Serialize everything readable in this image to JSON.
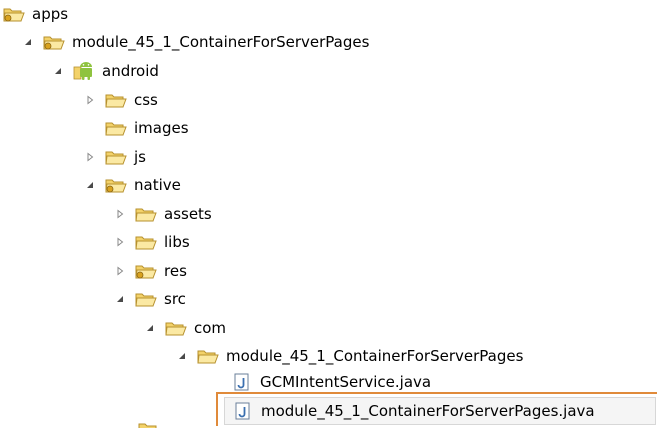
{
  "tree": {
    "items": [
      {
        "label": "apps",
        "icon": "project-folder-icon",
        "expander": "none"
      },
      {
        "label": "module_45_1_ContainerForServerPages",
        "icon": "project-folder-icon",
        "expander": "expanded"
      },
      {
        "label": "android",
        "icon": "android-icon",
        "expander": "expanded"
      },
      {
        "label": "css",
        "icon": "folder-icon",
        "expander": "collapsed"
      },
      {
        "label": "images",
        "icon": "folder-icon",
        "expander": "none"
      },
      {
        "label": "js",
        "icon": "folder-icon",
        "expander": "collapsed"
      },
      {
        "label": "native",
        "icon": "project-folder-icon",
        "expander": "expanded"
      },
      {
        "label": "assets",
        "icon": "folder-icon",
        "expander": "collapsed"
      },
      {
        "label": "libs",
        "icon": "folder-icon",
        "expander": "collapsed"
      },
      {
        "label": "res",
        "icon": "project-folder-icon",
        "expander": "collapsed"
      },
      {
        "label": "src",
        "icon": "folder-icon",
        "expander": "expanded"
      },
      {
        "label": "com",
        "icon": "package-folder-icon",
        "expander": "expanded"
      },
      {
        "label": "module_45_1_ContainerForServerPages",
        "icon": "package-folder-icon",
        "expander": "expanded"
      },
      {
        "label": "GCMIntentService.java",
        "icon": "java-file-icon",
        "expander": "none"
      },
      {
        "label": "module_45_1_ContainerForServerPages.java",
        "icon": "java-file-icon",
        "expander": "none",
        "selected": true
      }
    ]
  },
  "colors": {
    "folder_fill": "#f3d26a",
    "folder_stroke": "#b7912e",
    "selection_outline": "#e08a3a",
    "java_blue": "#3a6fb0",
    "android_green": "#8fc33f"
  }
}
